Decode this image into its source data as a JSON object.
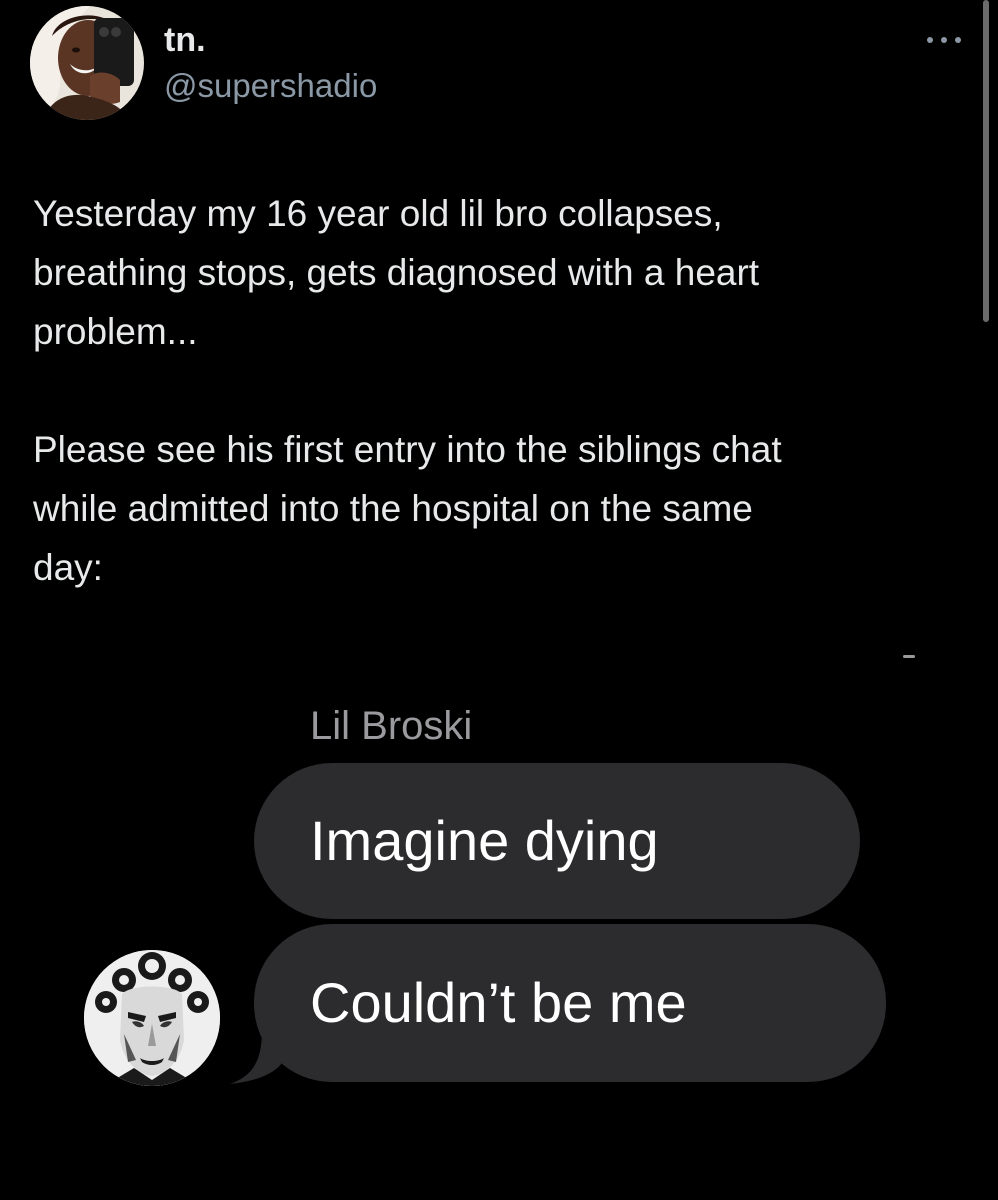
{
  "author": {
    "display_name": "tn.",
    "handle": "@supershadio",
    "avatar_icon": "profile-photo-icon"
  },
  "menu": {
    "icon": "more-options-icon"
  },
  "tweet": {
    "paragraph_1": "Yesterday my 16 year old lil bro collapses,\nbreathing stops, gets diagnosed with a heart\nproblem...",
    "paragraph_2": "Please see his first entry into the siblings chat\nwhile admitted into the hospital on the same\nday:"
  },
  "chat": {
    "sender_name": "Lil Broski",
    "messages": [
      "Imagine dying",
      "Couldn’t be me"
    ],
    "bubble_color": "#2c2c2e",
    "avatar_icon": "manga-character-avatar-icon"
  },
  "colors": {
    "background": "#000000",
    "text": "#e7e9ea",
    "secondary_text": "#8b98a5"
  }
}
